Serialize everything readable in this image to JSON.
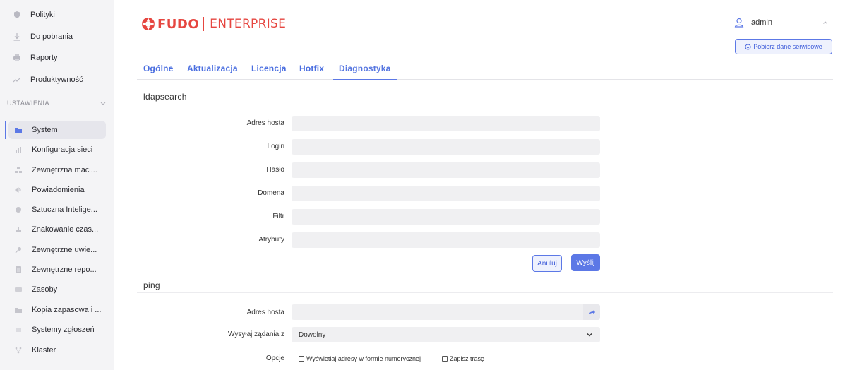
{
  "sidebar": {
    "top_items": [
      {
        "label": "Polityki",
        "icon": "shield-icon"
      },
      {
        "label": "Do pobrania",
        "icon": "download-icon"
      },
      {
        "label": "Raporty",
        "icon": "printer-icon"
      },
      {
        "label": "Produktywność",
        "icon": "chart-icon"
      }
    ],
    "section_label": "USTAWIENIA",
    "settings_items": [
      {
        "label": "System",
        "icon": "folder-icon",
        "active": true
      },
      {
        "label": "Konfiguracja sieci",
        "icon": "network-icon"
      },
      {
        "label": "Zewnętrzna maci...",
        "icon": "matrix-icon"
      },
      {
        "label": "Powiadomienia",
        "icon": "bell-icon"
      },
      {
        "label": "Sztuczna Intelige...",
        "icon": "ai-icon"
      },
      {
        "label": "Znakowanie czas...",
        "icon": "stamp-icon"
      },
      {
        "label": "Zewnętrzne uwie...",
        "icon": "key-icon"
      },
      {
        "label": "Zewnętrzne repo...",
        "icon": "repo-icon"
      },
      {
        "label": "Zasoby",
        "icon": "resources-icon"
      },
      {
        "label": "Kopia zapasowa i ...",
        "icon": "backup-icon"
      },
      {
        "label": "Systemy zgłoszeń",
        "icon": "ticket-icon"
      },
      {
        "label": "Klaster",
        "icon": "cluster-icon"
      }
    ]
  },
  "header": {
    "logo_brand": "FUDO",
    "logo_edition": "ENTERPRISE",
    "user_name": "admin",
    "service_button": "Pobierz dane serwisowe"
  },
  "tabs": [
    "Ogólne",
    "Aktualizacja",
    "Licencja",
    "Hotfix",
    "Diagnostyka"
  ],
  "active_tab": "Diagnostyka",
  "ldapsearch": {
    "title": "ldapsearch",
    "fields": [
      {
        "label": "Adres hosta",
        "value": ""
      },
      {
        "label": "Login",
        "value": ""
      },
      {
        "label": "Hasło",
        "value": ""
      },
      {
        "label": "Domena",
        "value": ""
      },
      {
        "label": "Filtr",
        "value": ""
      },
      {
        "label": "Atrybuty",
        "value": ""
      }
    ],
    "cancel_label": "Anuluj",
    "send_label": "Wyślij"
  },
  "ping": {
    "title": "ping",
    "host_label": "Adres hosta",
    "host_value": "",
    "source_label": "Wysyłaj żądania z",
    "source_value": "Dowolny",
    "options_label": "Opcje",
    "option_numeric": "Wyświetlaj adresy w formie numerycznej",
    "option_route": "Zapisz trasę"
  },
  "colors": {
    "accent": "#5c78e6",
    "brand": "#e64640",
    "sidebar_bg": "#f4f4f6",
    "input_bg": "#f0f0f2"
  }
}
